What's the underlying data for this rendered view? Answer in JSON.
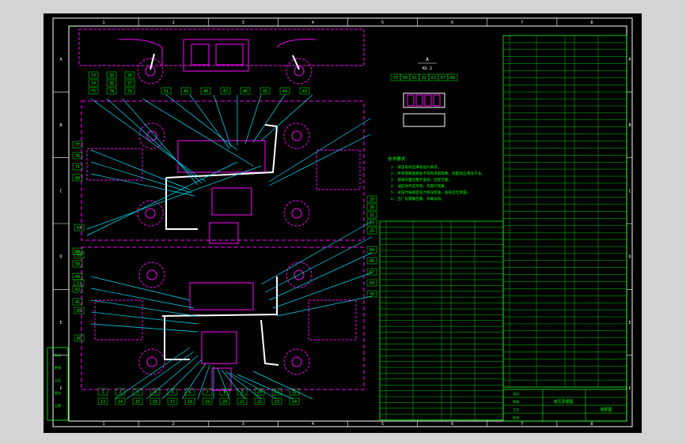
{
  "colors": {
    "window_bg": "#d4d4d4",
    "drawing_bg": "#000000",
    "frame": "#ffffff",
    "layout_line": "#ff00ff",
    "leader_line": "#00e5ff",
    "table_line": "#00ff00",
    "label_text": "#00ff00",
    "accent_text": "#ffff00",
    "callout_text": "#ffffff"
  },
  "border": {
    "top_zone_numbers": [
      "1",
      "2",
      "3",
      "4",
      "5",
      "6",
      "7",
      "8"
    ],
    "bottom_zone_numbers": [
      "1",
      "2",
      "3",
      "4",
      "5",
      "6",
      "7",
      "8"
    ],
    "left_zone_letters": [
      "A",
      "B",
      "C",
      "D",
      "E",
      "F"
    ],
    "right_zone_letters": [
      "A",
      "B",
      "C",
      "D",
      "E",
      "F"
    ]
  },
  "view_label": {
    "title": "A",
    "subtitle": "Kk 2"
  },
  "callouts": {
    "upper_row_1": [
      "73",
      "38",
      "35"
    ],
    "upper_row_2": [
      "74",
      "36",
      "37"
    ],
    "upper_row_3": [
      "75",
      "78",
      "79"
    ],
    "upper_top": [
      "51",
      "49",
      "48",
      "47",
      "46",
      "45",
      "44",
      "43"
    ],
    "upper_left": [
      "77",
      "76",
      "71",
      "80"
    ],
    "mid_right": [
      "29",
      "30",
      "31",
      "27",
      "25"
    ],
    "lower_left": [
      "38",
      "39",
      "40",
      "42",
      "41"
    ],
    "lower_right": [
      "64",
      "66",
      "67",
      "69",
      "70"
    ],
    "bottom_row": [
      "1",
      "2",
      "3",
      "4",
      "5",
      "6",
      "7",
      "8",
      "9",
      "10",
      "11",
      "12",
      "13",
      "14",
      "15",
      "16",
      "17",
      "18",
      "19",
      "20",
      "21",
      "22",
      "23",
      "24"
    ],
    "sidebar_labels": [
      "84",
      "59",
      "53",
      "85",
      "86"
    ],
    "valve_callouts": [
      "53",
      "60",
      "61",
      "62",
      "63",
      "67",
      "68"
    ]
  },
  "notes": {
    "heading": "技术要求：",
    "lines": [
      "1. 液压系统应满足设计要求。",
      "2. 所有管路连接处不得有渗漏现象，装配前应清洗干净。",
      "3. 管路布置应整齐美观，固定可靠。",
      "4. 油缸动作应平稳，无爬行现象。",
      "5. 试压时按规定压力保压检查，各处应无渗漏。",
      "6. 出厂前需做空载、负载试验。"
    ]
  },
  "left_stamp": {
    "cells": [
      "标记",
      "更改",
      "分区",
      "签名",
      "日期"
    ]
  },
  "title_block": {
    "label": "液压原理图",
    "sub_label": "装配图",
    "cells": [
      "设计",
      "审核",
      "工艺",
      "批准"
    ]
  },
  "parts_list_right": {
    "rows": 50
  },
  "parts_list_mid": {
    "rows": 34
  }
}
